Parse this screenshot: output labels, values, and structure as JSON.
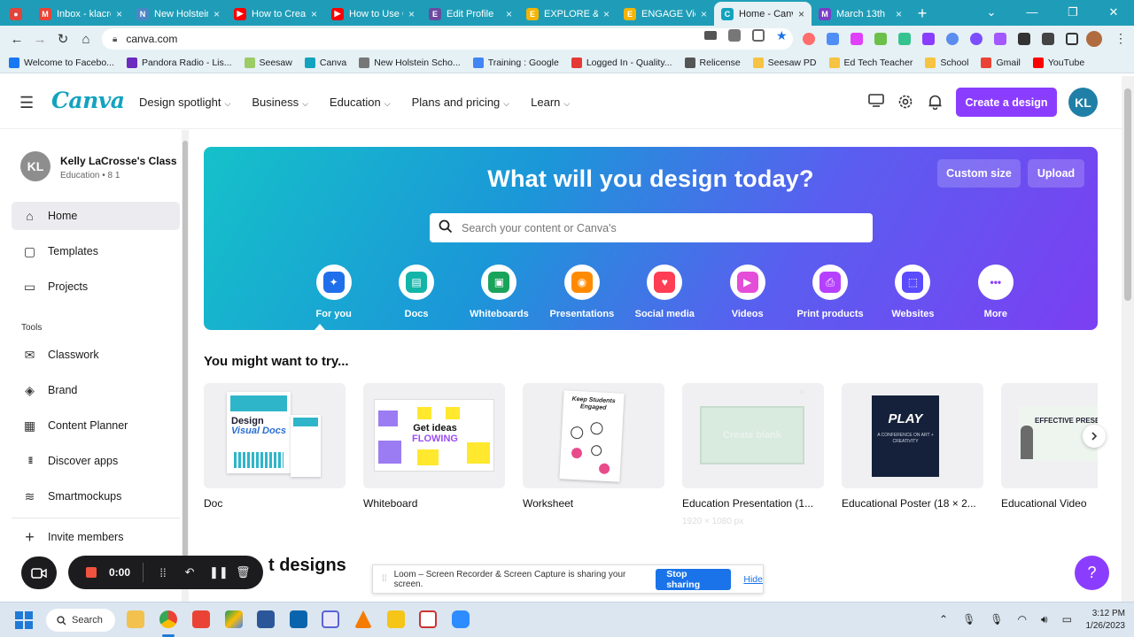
{
  "browser": {
    "tabs": [
      {
        "label": "",
        "color": "#e0443a",
        "glyph": "●",
        "active": false,
        "first": true
      },
      {
        "label": "Inbox - klacros",
        "color": "#ea4335",
        "glyph": "M",
        "active": false
      },
      {
        "label": "New Holstein",
        "color": "#4a86c5",
        "glyph": "N",
        "active": false
      },
      {
        "label": "How to Create",
        "color": "#ff0000",
        "glyph": "▶",
        "active": false
      },
      {
        "label": "How to Use C",
        "color": "#ff0000",
        "glyph": "▶",
        "active": false
      },
      {
        "label": "Edit Profile",
        "color": "#6b4aa0",
        "glyph": "E",
        "active": false
      },
      {
        "label": "EXPLORE & C",
        "color": "#f4b400",
        "glyph": "E",
        "active": false
      },
      {
        "label": "ENGAGE View",
        "color": "#f4b400",
        "glyph": "E",
        "active": false
      },
      {
        "label": "Home - Canva",
        "color": "#13a3bf",
        "glyph": "C",
        "active": true
      },
      {
        "label": "March 13th",
        "color": "#7b3fc6",
        "glyph": "M",
        "active": false
      }
    ],
    "url": "canva.com",
    "bookmarks": [
      {
        "label": "Welcome to Facebo...",
        "color": "#1877f2"
      },
      {
        "label": "Pandora Radio - Lis...",
        "color": "#6b2bbf"
      },
      {
        "label": "Seesaw",
        "color": "#9ccc65"
      },
      {
        "label": "Canva",
        "color": "#13a3bf"
      },
      {
        "label": "New Holstein Scho...",
        "color": "#777777"
      },
      {
        "label": "Training : Google",
        "color": "#4285f4"
      },
      {
        "label": "Logged In - Quality...",
        "color": "#e53935"
      },
      {
        "label": "Relicense",
        "color": "#555555"
      },
      {
        "label": "Seesaw PD",
        "color": "#f6c343"
      },
      {
        "label": "Ed Tech Teacher",
        "color": "#f6c343"
      },
      {
        "label": "School",
        "color": "#f6c343"
      },
      {
        "label": "Gmail",
        "color": "#ea4335"
      },
      {
        "label": "YouTube",
        "color": "#ff0000"
      }
    ]
  },
  "header": {
    "logo": "Canva",
    "nav": [
      "Design spotlight",
      "Business",
      "Education",
      "Plans and pricing",
      "Learn"
    ],
    "create_label": "Create a design",
    "avatar_initials": "KL",
    "accent": "#8b3dff"
  },
  "sidebar": {
    "account_initials": "KL",
    "account_name": "Kelly LaCrosse's Class",
    "account_sub": "Education • 8 1",
    "items": [
      {
        "label": "Home",
        "icon": "home-icon",
        "glyph": "⌂"
      },
      {
        "label": "Templates",
        "icon": "templates-icon",
        "glyph": "▢"
      },
      {
        "label": "Projects",
        "icon": "folder-icon",
        "glyph": "▭"
      }
    ],
    "tools_heading": "Tools",
    "tools": [
      {
        "label": "Classwork",
        "icon": "inbox-icon",
        "glyph": "✉"
      },
      {
        "label": "Brand",
        "icon": "brand-icon",
        "glyph": "◈"
      },
      {
        "label": "Content Planner",
        "icon": "calendar-icon",
        "glyph": "▦"
      },
      {
        "label": "Discover apps",
        "icon": "apps-grid-icon",
        "glyph": "⁞⁞⁞"
      },
      {
        "label": "Smartmockups",
        "icon": "layers-icon",
        "glyph": "≋"
      }
    ],
    "invite_label": "Invite members"
  },
  "hero": {
    "title": "What will you design today?",
    "custom_size_label": "Custom size",
    "upload_label": "Upload",
    "search_placeholder": "Search your content or Canva's",
    "categories": [
      {
        "label": "For you",
        "icon": "sparkle-icon",
        "color": "#1f6feb",
        "glyph": "✦"
      },
      {
        "label": "Docs",
        "icon": "docs-icon",
        "color": "#13b5a8",
        "glyph": "▤"
      },
      {
        "label": "Whiteboards",
        "icon": "whiteboard-icon",
        "color": "#1aa35a",
        "glyph": "▣"
      },
      {
        "label": "Presentations",
        "icon": "presentation-icon",
        "color": "#ff8a00",
        "glyph": "◉"
      },
      {
        "label": "Social media",
        "icon": "heart-icon",
        "color": "#ff3d55",
        "glyph": "♥"
      },
      {
        "label": "Videos",
        "icon": "video-icon",
        "color": "#e44dd8",
        "glyph": "▶"
      },
      {
        "label": "Print products",
        "icon": "printer-icon",
        "color": "#b640ff",
        "glyph": "⎙"
      },
      {
        "label": "Websites",
        "icon": "website-icon",
        "color": "#5a4bff",
        "glyph": "⬚"
      },
      {
        "label": "More",
        "icon": "more-icon",
        "color": "#8b3dff",
        "glyph": "•••"
      }
    ]
  },
  "try_section": {
    "title": "You might want to try...",
    "cards": [
      {
        "label": "Doc",
        "thumb_text_1": "Design",
        "thumb_text_2": "Visual Docs"
      },
      {
        "label": "Whiteboard",
        "thumb_text_1": "Get ideas",
        "thumb_text_2": "FLOWING"
      },
      {
        "label": "Worksheet",
        "thumb_text_1": "Keep Students Engaged",
        "thumb_text_2": ""
      },
      {
        "label": "Education Presentation (1...",
        "thumb_text_1": "Create blank",
        "thumb_text_2": ""
      },
      {
        "label": "Educational Poster (18 × 2...",
        "thumb_text_1": "PLAY",
        "thumb_text_2": "A CONFERENCE ON ART + CREATIVITY"
      },
      {
        "label": "Educational Video",
        "thumb_text_1": "EFFECTIVE PRESENT",
        "thumb_text_2": ""
      }
    ],
    "presentation_sub": "1920 × 1080 px"
  },
  "recent": {
    "title": "Recent designs",
    "visible_title": "t designs"
  },
  "loom": {
    "time": "0:00",
    "share_text": "Loom – Screen Recorder & Screen Capture is sharing your screen.",
    "stop_label": "Stop sharing",
    "hide_label": "Hide"
  },
  "help_label": "?",
  "taskbar": {
    "search_label": "Search",
    "time": "3:12 PM",
    "date": "1/26/2023"
  }
}
